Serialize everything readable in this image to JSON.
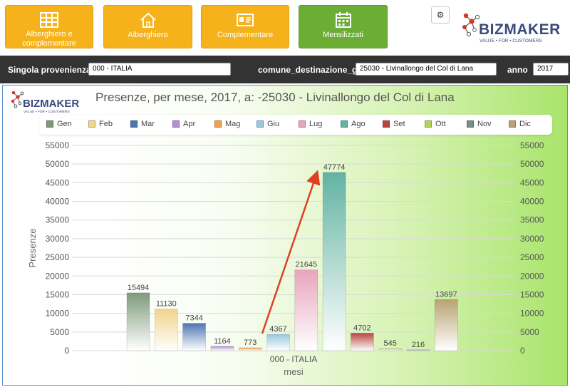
{
  "nav": {
    "buttons": [
      {
        "label": "Alberghiero e complementare",
        "icon": "grid-table-icon"
      },
      {
        "label": "Alberghiero",
        "icon": "house-icon"
      },
      {
        "label": "Complementare",
        "icon": "id-card-icon"
      },
      {
        "label": "Mensilizzati",
        "icon": "calendar-icon"
      }
    ],
    "settings_icon": "gear-icon"
  },
  "brand": {
    "name": "BIZMAKER",
    "tagline": "VALUE • FOR • CUSTOMERS",
    "color_primary": "#3a4a7a",
    "color_accent": "#d7332b"
  },
  "filters": {
    "provenienza_label": "Singola provenienza:",
    "provenienza_value": "000 - ITALIA",
    "destinazione_label": "comune_destinazione_g",
    "destinazione_value": "25030 - Livinallongo del Col di Lana",
    "anno_label": "anno",
    "anno_value": "2017"
  },
  "colors": {
    "nav_orange": "#f6b21a",
    "nav_green": "#6cae35",
    "filter_bar": "#333333",
    "arrow": "#e0401f"
  },
  "chart_data": {
    "type": "bar",
    "title": "Presenze, per mese, 2017, a: -25030 - Livinallongo del Col di Lana",
    "xlabel": "mesi",
    "ylabel": "Presenze",
    "categories": [
      "000 - ITALIA"
    ],
    "ylim": [
      0,
      55000
    ],
    "yticks": [
      0,
      5000,
      10000,
      15000,
      20000,
      25000,
      30000,
      35000,
      40000,
      45000,
      50000,
      55000
    ],
    "grid": true,
    "legend_position": "top",
    "series": [
      {
        "name": "Gen",
        "values": [
          15494
        ],
        "color": "#7f9a7a"
      },
      {
        "name": "Feb",
        "values": [
          11130
        ],
        "color": "#f2d48a"
      },
      {
        "name": "Mar",
        "values": [
          7344
        ],
        "color": "#4f76b2"
      },
      {
        "name": "Apr",
        "values": [
          1164
        ],
        "color": "#b28fd4"
      },
      {
        "name": "Mag",
        "values": [
          773
        ],
        "color": "#f4a04a"
      },
      {
        "name": "Giu",
        "values": [
          4367
        ],
        "color": "#98c8df"
      },
      {
        "name": "Lug",
        "values": [
          21645
        ],
        "color": "#e8a4be"
      },
      {
        "name": "Ago",
        "values": [
          47774
        ],
        "color": "#62b3a2"
      },
      {
        "name": "Set",
        "values": [
          4702
        ],
        "color": "#b8463c"
      },
      {
        "name": "Ott",
        "values": [
          545
        ],
        "color": "#b5d35a"
      },
      {
        "name": "Nov",
        "values": [
          216
        ],
        "color": "#7d8d88"
      },
      {
        "name": "Dic",
        "values": [
          13697
        ],
        "color": "#b8a373"
      }
    ]
  }
}
